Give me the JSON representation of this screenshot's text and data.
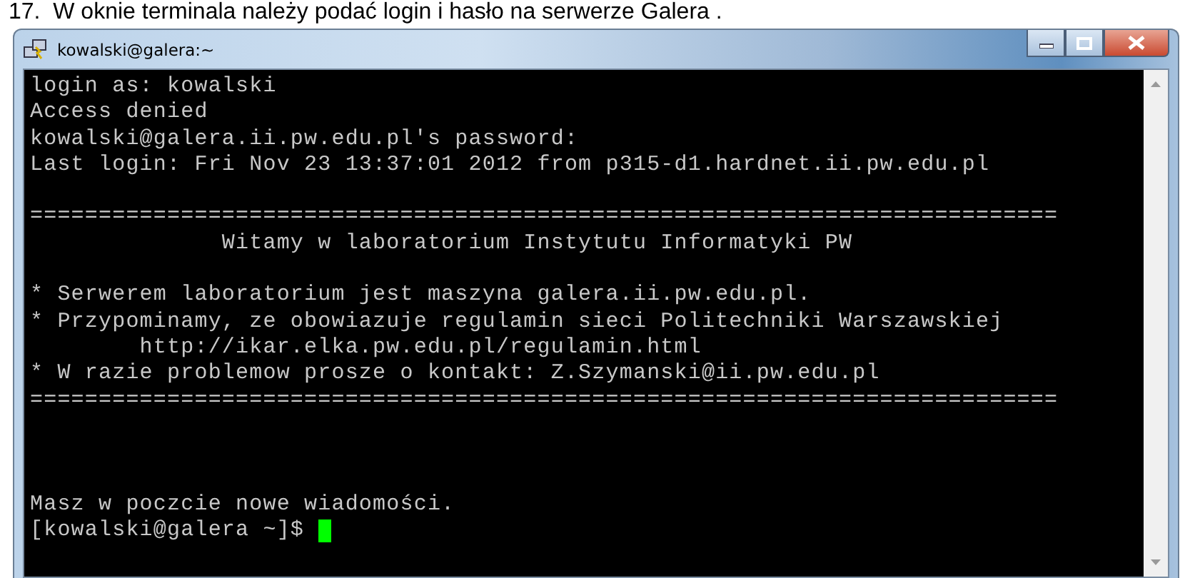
{
  "caption": "17.  W oknie terminala należy podać login i hasło na serwerze Galera .",
  "window": {
    "title": "kowalski@galera:~"
  },
  "terminal": {
    "lines": [
      {
        "kind": "text",
        "text": "login as: kowalski"
      },
      {
        "kind": "text",
        "text": "Access denied"
      },
      {
        "kind": "text",
        "text": "kowalski@galera.ii.pw.edu.pl's password:"
      },
      {
        "kind": "text",
        "text": "Last login: Fri Nov 23 13:37:01 2012 from p315-d1.hardnet.ii.pw.edu.pl"
      },
      {
        "kind": "blank"
      },
      {
        "kind": "text",
        "text": "==========================================================================="
      },
      {
        "kind": "text",
        "text": "              Witamy w laboratorium Instytutu Informatyki PW"
      },
      {
        "kind": "blank"
      },
      {
        "kind": "text",
        "text": "* Serwerem laboratorium jest maszyna galera.ii.pw.edu.pl."
      },
      {
        "kind": "text",
        "text": "* Przypominamy, ze obowiazuje regulamin sieci Politechniki Warszawskiej"
      },
      {
        "kind": "text",
        "text": "        http://ikar.elka.pw.edu.pl/regulamin.html"
      },
      {
        "kind": "text",
        "text": "* W razie problemow prosze o kontakt: Z.Szymanski@ii.pw.edu.pl"
      },
      {
        "kind": "text",
        "text": "==========================================================================="
      },
      {
        "kind": "blank"
      },
      {
        "kind": "blank"
      },
      {
        "kind": "blank"
      },
      {
        "kind": "text",
        "text": "Masz w poczcie nowe wiadomości."
      },
      {
        "kind": "prompt",
        "text": "[kowalski@galera ~]$ "
      }
    ]
  }
}
